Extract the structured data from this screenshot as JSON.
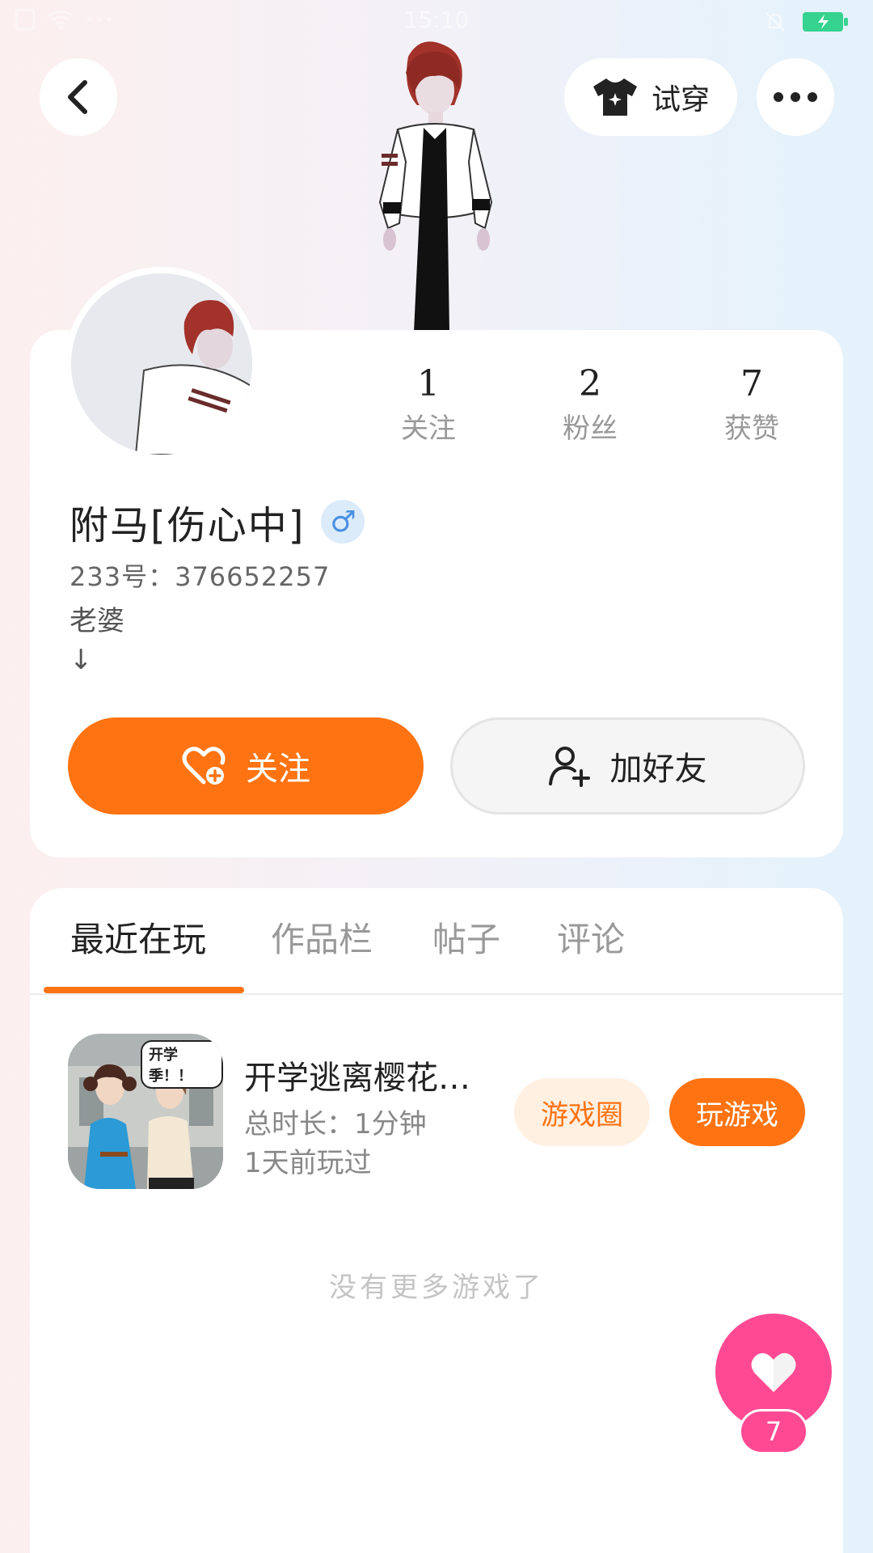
{
  "status_bar": {
    "time": "15:10"
  },
  "header": {
    "try_on_label": "试穿",
    "icons": [
      "back-arrow-icon",
      "tshirt-icon",
      "more-dots-icon"
    ]
  },
  "profile": {
    "stats": [
      {
        "value": "1",
        "label": "关注"
      },
      {
        "value": "2",
        "label": "粉丝"
      },
      {
        "value": "7",
        "label": "获赞"
      }
    ],
    "name": "附马[伤心中]",
    "gender_symbol": "♂",
    "uid": "233号：376652257",
    "bio": "老婆\n↓",
    "follow_label": "关注",
    "add_friend_label": "加好友"
  },
  "tabs": [
    {
      "label": "最近在玩",
      "active": true
    },
    {
      "label": "作品栏",
      "active": false
    },
    {
      "label": "帖子",
      "active": false
    },
    {
      "label": "评论",
      "active": false
    }
  ],
  "games": [
    {
      "icon_badge": "开学季！！",
      "title": "开学逃离樱花…",
      "duration": "总时长：1分钟",
      "last_played": "1天前玩过",
      "circle_label": "游戏圈",
      "play_label": "玩游戏"
    }
  ],
  "no_more_text": "没有更多游戏了",
  "like_fab": {
    "count": "7"
  },
  "colors": {
    "accent": "#ff7312",
    "like": "#ff4a93",
    "gender": "#4a8fe0"
  }
}
